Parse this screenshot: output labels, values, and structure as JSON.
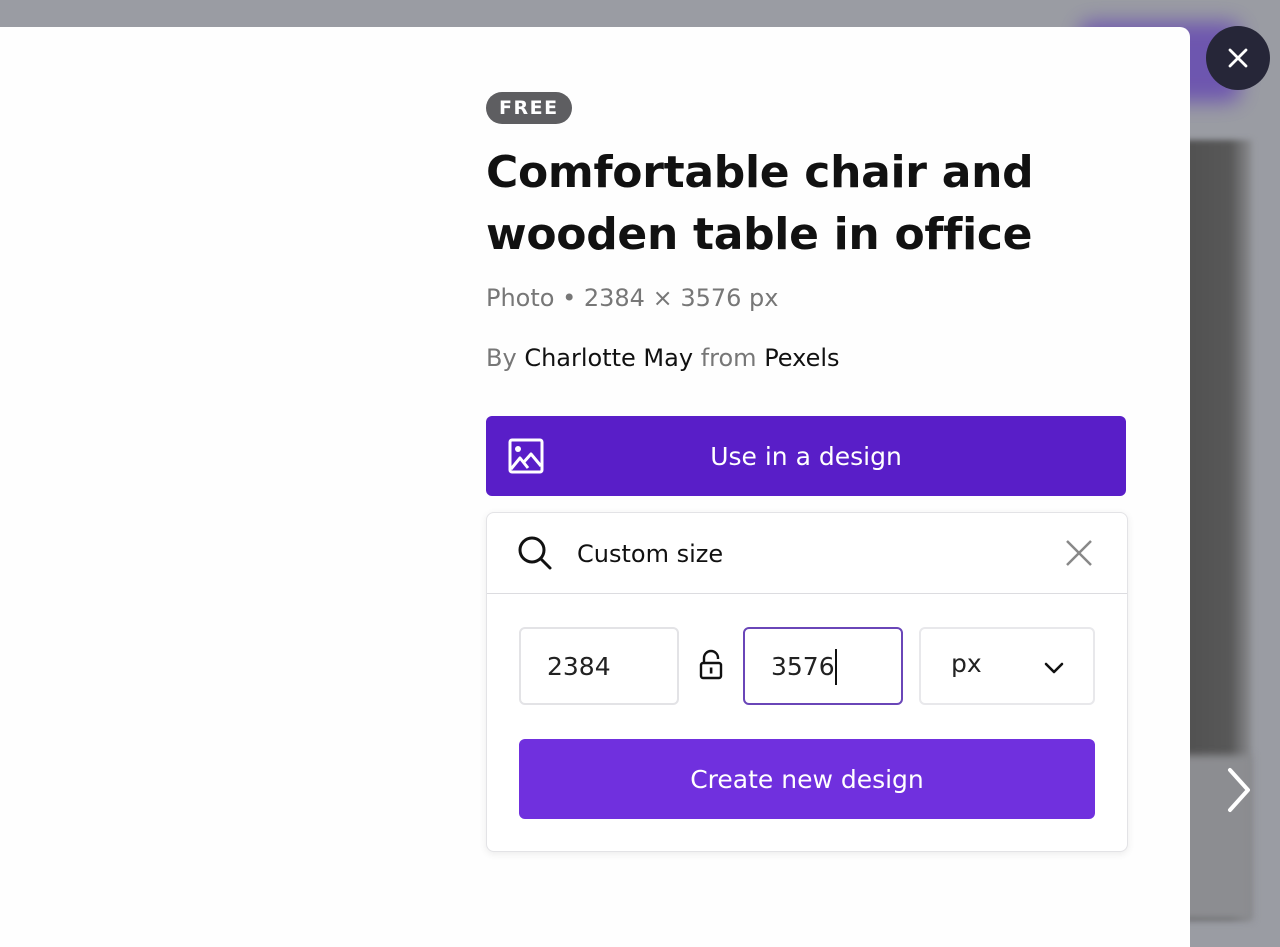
{
  "detail": {
    "badge": "FREE",
    "title": "Comfortable chair and wooden table in office",
    "meta": "Photo • 2384 × 3576 px",
    "byline": {
      "by": "By",
      "author": "Charlotte May",
      "from": "from",
      "source": "Pexels"
    }
  },
  "use_button": {
    "label": "Use in a design",
    "icon": "image-icon"
  },
  "design_panel": {
    "search": {
      "value": "Custom size",
      "icon": "search-icon",
      "clear_icon": "close-icon"
    },
    "width": "2384",
    "height": "3576",
    "lock_icon": "unlocked-padlock-icon",
    "unit": "px",
    "create_label": "Create new design"
  },
  "overlay": {
    "close_icon": "close-icon",
    "next_icon": "chevron-right-icon"
  },
  "colors": {
    "use_button": "#591ec8",
    "create_button": "#7030de",
    "focus_border": "#6a46b8",
    "badge": "#5e5e61",
    "close_button": "#262638"
  }
}
